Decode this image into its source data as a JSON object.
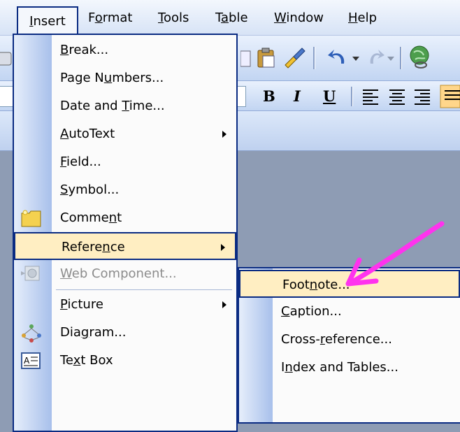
{
  "menubar": {
    "items": [
      {
        "label": "Insert",
        "mnemonic_index": 0
      },
      {
        "label": "Format",
        "mnemonic_index": 1
      },
      {
        "label": "Tools",
        "mnemonic_index": 0
      },
      {
        "label": "Table",
        "mnemonic_index": 1
      },
      {
        "label": "Window",
        "mnemonic_index": 0
      },
      {
        "label": "Help",
        "mnemonic_index": 0
      }
    ]
  },
  "toolbar": {
    "bold": "B",
    "italic": "I",
    "underline": "U"
  },
  "insert_menu": {
    "items": [
      {
        "label": "Break...",
        "mn": 0
      },
      {
        "label": "Page Numbers...",
        "mn": 6
      },
      {
        "label": "Date and Time...",
        "mn": 9
      },
      {
        "label": "AutoText",
        "mn": 0,
        "submenu": true
      },
      {
        "label": "Field...",
        "mn": 0
      },
      {
        "label": "Symbol...",
        "mn": 0
      },
      {
        "label": "Comment",
        "mn": 5,
        "icon": "comment-icon"
      },
      {
        "label": "Reference",
        "mn": 6,
        "submenu": true,
        "highlight": true
      },
      {
        "label": "Web Component...",
        "mn": 0,
        "disabled": true,
        "icon": "web-component-icon"
      },
      {
        "label": "Picture",
        "mn": 0,
        "submenu": true
      },
      {
        "label": "Diagram...",
        "mn": 3,
        "icon": "diagram-icon"
      },
      {
        "label": "Text Box",
        "mn": 2,
        "icon": "text-box-icon"
      }
    ]
  },
  "reference_submenu": {
    "items": [
      {
        "label": "Footnote...",
        "mn": 4,
        "highlight": true
      },
      {
        "label": "Caption...",
        "mn": 0
      },
      {
        "label": "Cross-reference...",
        "mn": 6
      },
      {
        "label": "Index and Tables...",
        "mn": 1
      }
    ]
  },
  "colors": {
    "menu_border": "#0a2b82",
    "highlight": "#ffeec2",
    "annotation_arrow": "#ff33ee"
  }
}
